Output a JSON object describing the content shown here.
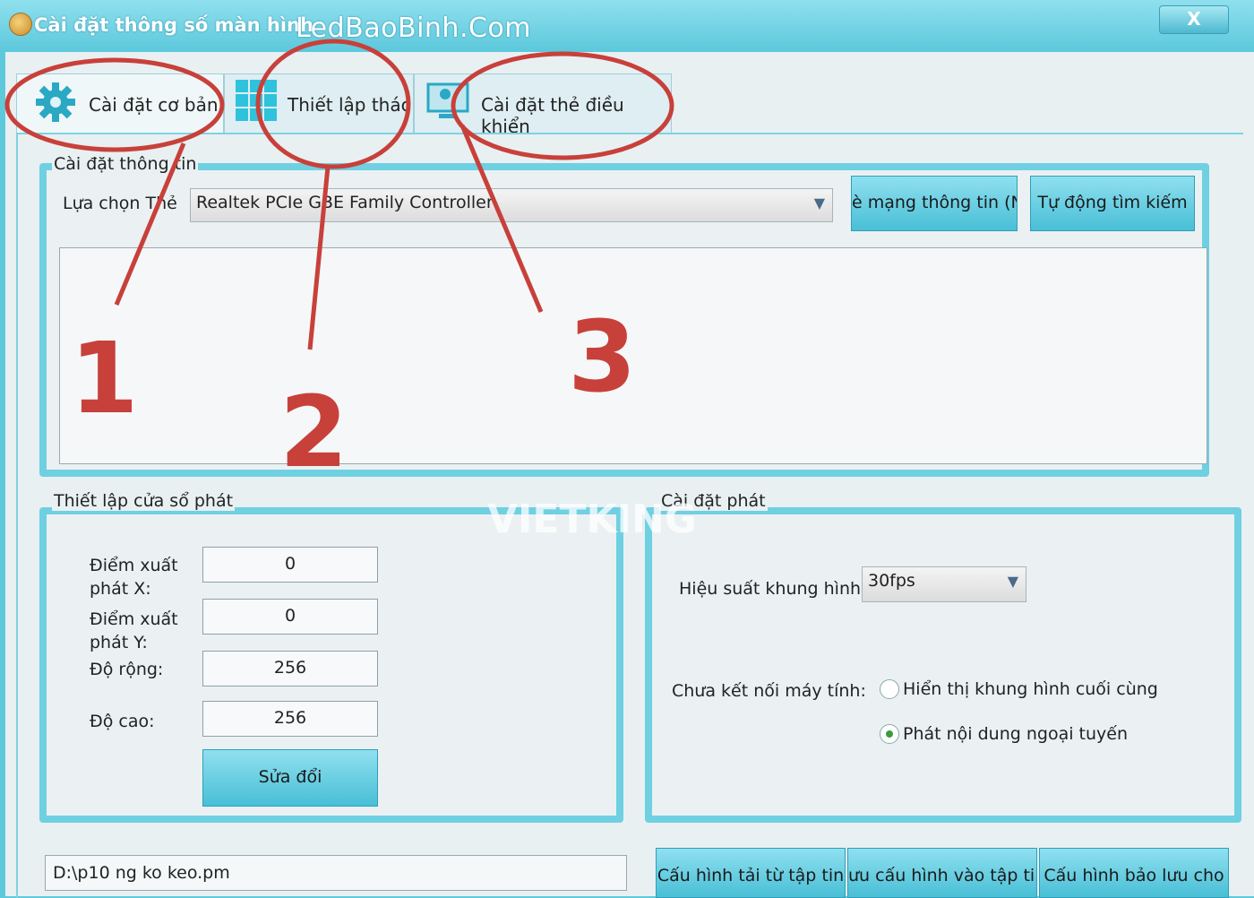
{
  "window": {
    "title": "Cài đặt thông số màn hình",
    "site": "LedBaoBinh.Com",
    "close_label": "X"
  },
  "tabs": [
    {
      "label": "Cài đặt cơ bản",
      "icon": "gear-icon"
    },
    {
      "label": "Thiết lập thác",
      "icon": "grid-icon"
    },
    {
      "label": "Cài đặt thẻ điều khiển",
      "icon": "monitor-icon"
    }
  ],
  "info_group": {
    "title": "Cài đặt thông tin",
    "select_label": "Lựa chọn Thẻ",
    "card_value": "Realtek PCIe GBE Family Controller",
    "info_button": "è mạng thông tin (N",
    "auto_button": "Tự động tìm kiếm"
  },
  "window_group": {
    "title": "Thiết lập cửa sổ phát",
    "x_label": "Điểm xuất phát X:",
    "x_value": "0",
    "y_label": "Điểm xuất phát Y:",
    "y_value": "0",
    "width_label": "Độ rộng:",
    "width_value": "256",
    "height_label": "Độ cao:",
    "height_value": "256",
    "modify_button": "Sửa đổi"
  },
  "play_group": {
    "title": "Cài đặt phát",
    "fps_label": "Hiệu suất khung hình",
    "fps_value": "30fps",
    "disconnected_label": "Chưa kết nối máy tính:",
    "opt1": "Hiển thị khung hình cuối cùng",
    "opt2": "Phát nội dung ngoại tuyến",
    "selected_option": 2
  },
  "footer": {
    "path": "D:\\p10 ng ko keo.pm",
    "load_button": "Cấu hình tải từ tập tin",
    "save_button": "ưu cấu hình vào tập tin",
    "backup_button": "Cấu hình bảo lưu cho"
  },
  "annotations": {
    "n1": "1",
    "n2": "2",
    "n3": "3",
    "color": "#c8403a"
  },
  "watermark": {
    "text": "VIETKING"
  },
  "colors": {
    "accent": "#5fc9dc",
    "button": "#49bfd6"
  }
}
